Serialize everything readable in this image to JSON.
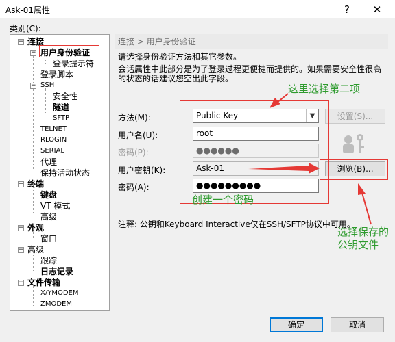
{
  "window": {
    "title": "Ask-01属性",
    "help": "?",
    "close": "✕"
  },
  "category_label": "类别(C):",
  "tree": {
    "connection": "连接",
    "user_auth": "用户身份验证",
    "login_prompt": "登录提示符",
    "login_script": "登录脚本",
    "ssh": "SSH",
    "security": "安全性",
    "tunnel": "隧道",
    "sftp": "SFTP",
    "telnet": "TELNET",
    "rlogin": "RLOGIN",
    "serial": "SERIAL",
    "proxy": "代理",
    "keepalive": "保持活动状态",
    "terminal": "终端",
    "keyboard": "键盘",
    "vt_mode": "VT 模式",
    "advanced1": "高级",
    "appearance": "外观",
    "window": "窗口",
    "advanced2": "高级",
    "trace": "跟踪",
    "log": "日志记录",
    "file_transfer": "文件传输",
    "xymodem": "X/YMODEM",
    "zmodem": "ZMODEM"
  },
  "panel": {
    "header": "连接 > 用户身份验证",
    "desc1": "请选择身份验证方法和其它参数。",
    "desc2": "会话属性中此部分是为了登录过程更便捷而提供的。如果需要安全性很高",
    "desc3": "的状态的话建议您空出此字段。",
    "method_label": "方法(M):",
    "method_value": "Public Key",
    "settings_button": "设置(S)...",
    "username_label": "用户名(U):",
    "username_value": "root",
    "password_label_disabled": "密码(P):",
    "password_value_disabled": "●●●●●●",
    "userkey_label": "用户密钥(K):",
    "userkey_value": "Ask-01",
    "browse_button": "浏览(B)...",
    "passphrase_label": "密码(A):",
    "passphrase_value": "●●●●●●●●●",
    "note": "注释: 公钥和Keyboard Interactive仅在SSH/SFTP协议中可用。"
  },
  "buttons": {
    "ok": "确定",
    "cancel": "取消"
  },
  "annotations": {
    "select_second": "这里选择第二项",
    "create_password": "创建一个密码",
    "choose_key_1": "选择保存的",
    "choose_key_2": "公钥文件"
  },
  "colors": {
    "annotation_green": "#2e9b2e",
    "annotation_red": "#e53935",
    "accent": "#0078d7"
  }
}
